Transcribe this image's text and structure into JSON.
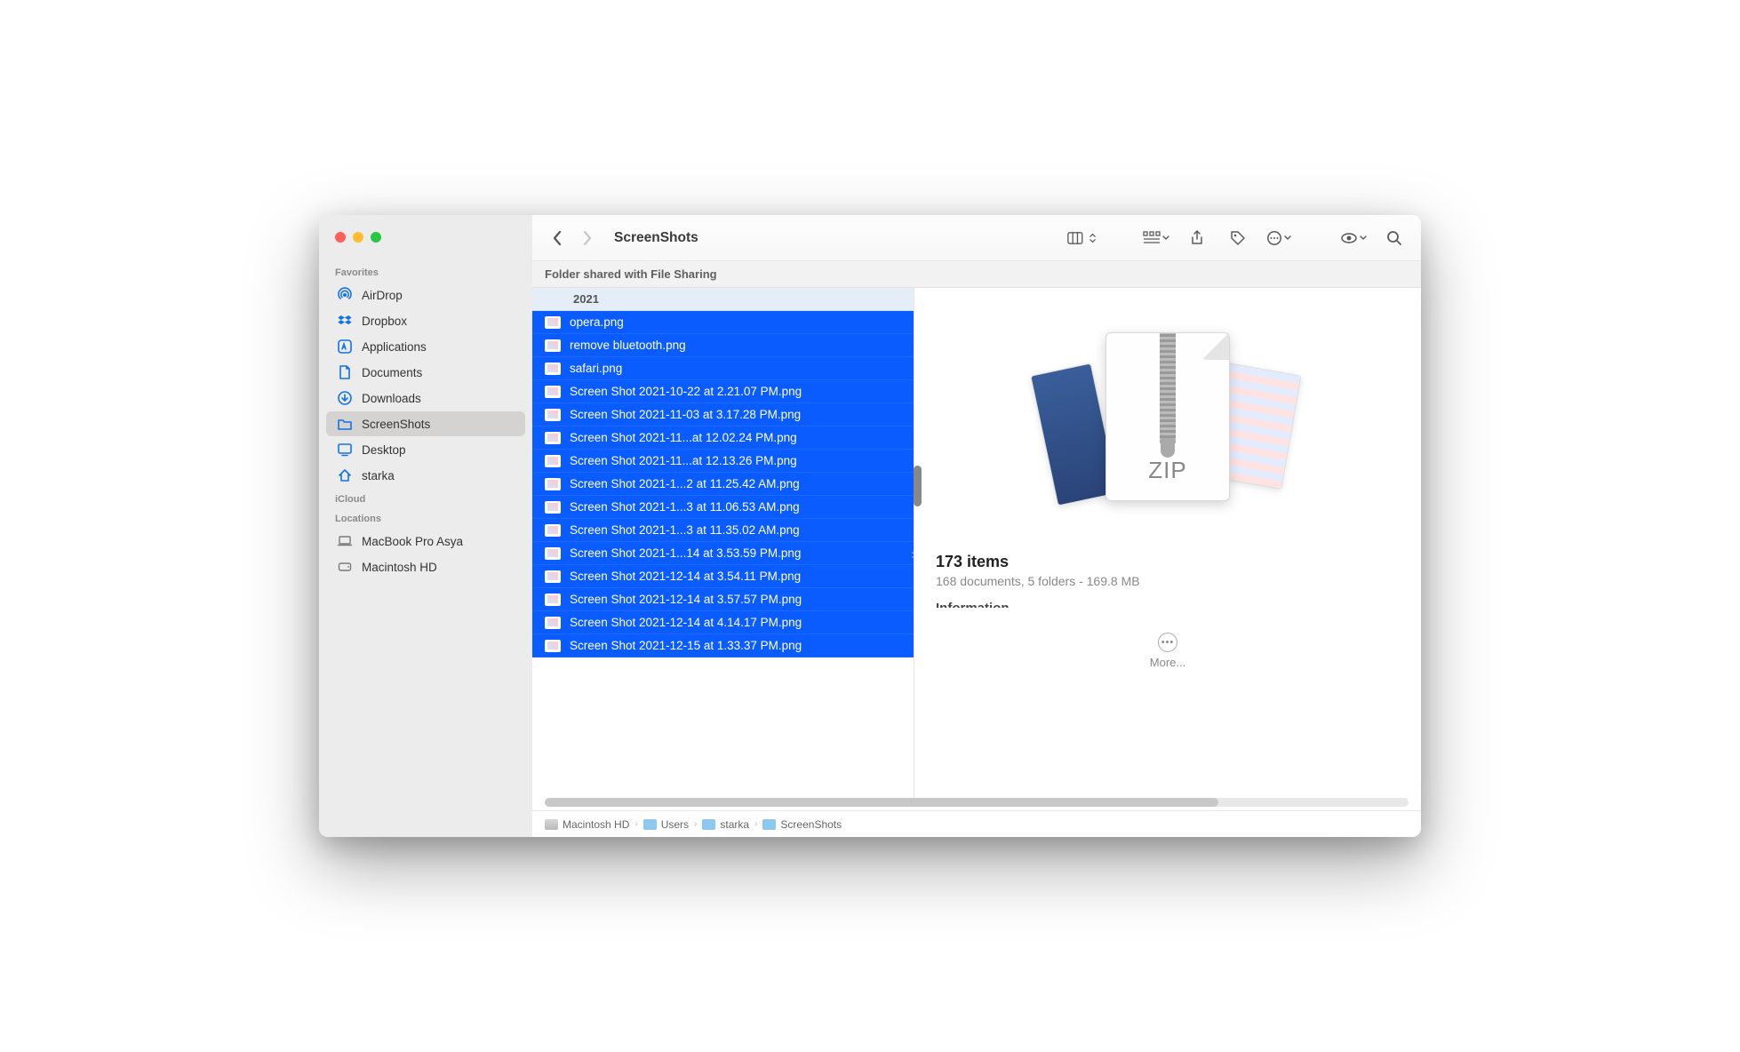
{
  "window": {
    "title": "ScreenShots"
  },
  "banner": "Folder shared with File Sharing",
  "sidebar": {
    "sections": [
      {
        "title": "Favorites",
        "items": [
          {
            "icon": "airdrop",
            "label": "AirDrop"
          },
          {
            "icon": "dropbox",
            "label": "Dropbox"
          },
          {
            "icon": "applications",
            "label": "Applications"
          },
          {
            "icon": "documents",
            "label": "Documents"
          },
          {
            "icon": "downloads",
            "label": "Downloads"
          },
          {
            "icon": "folder",
            "label": "ScreenShots",
            "active": true
          },
          {
            "icon": "desktop",
            "label": "Desktop"
          },
          {
            "icon": "home",
            "label": "starka"
          }
        ]
      },
      {
        "title": "iCloud",
        "items": []
      },
      {
        "title": "Locations",
        "items": [
          {
            "icon": "laptop",
            "label": "MacBook Pro Asya"
          },
          {
            "icon": "disk",
            "label": "Macintosh HD"
          }
        ]
      }
    ]
  },
  "column": {
    "group": "2021",
    "files": [
      "opera.png",
      "remove bluetooth.png",
      "safari.png",
      "Screen Shot 2021-10-22 at 2.21.07 PM.png",
      "Screen Shot 2021-11-03 at 3.17.28 PM.png",
      "Screen Shot 2021-11...at 12.02.24 PM.png",
      "Screen Shot 2021-11...at 12.13.26 PM.png",
      "Screen Shot 2021-1...2 at 11.25.42 AM.png",
      "Screen Shot 2021-1...3 at 11.06.53 AM.png",
      "Screen Shot 2021-1...3 at 11.35.02 AM.png",
      "Screen Shot 2021-1...14 at 3.53.59 PM.png",
      "Screen Shot 2021-12-14 at 3.54.11 PM.png",
      "Screen Shot 2021-12-14 at 3.57.57 PM.png",
      "Screen Shot 2021-12-14 at 4.14.17 PM.png",
      "Screen Shot 2021-12-15 at 1.33.37 PM.png"
    ]
  },
  "preview": {
    "zip_label": "ZIP",
    "count_line": "173 items",
    "detail_line": "168 documents, 5 folders - 169.8 MB",
    "info_heading": "Information",
    "more_label": "More..."
  },
  "pathbar": [
    {
      "icon": "hd",
      "label": "Macintosh HD"
    },
    {
      "icon": "folder",
      "label": "Users"
    },
    {
      "icon": "folder",
      "label": "starka"
    },
    {
      "icon": "folder",
      "label": "ScreenShots"
    }
  ]
}
